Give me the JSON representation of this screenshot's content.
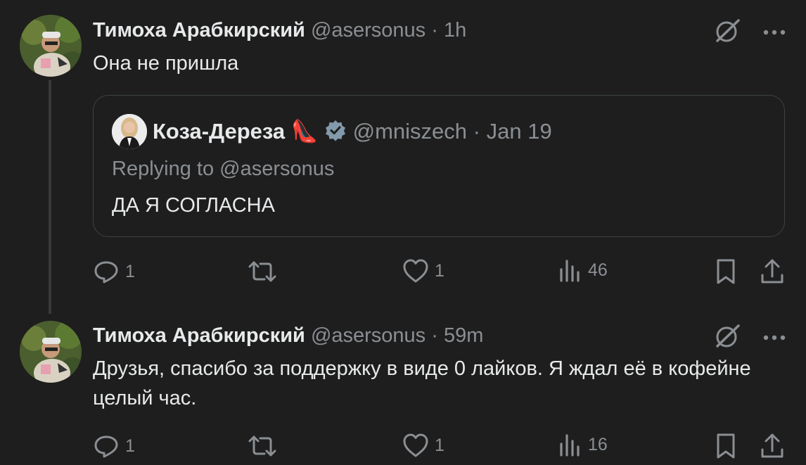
{
  "tweets": [
    {
      "author_name": "Тимоха Арабкирский",
      "handle": "@asersonus",
      "separator": "·",
      "time": "1h",
      "text": "Она не пришла",
      "quote": {
        "author_name": "Коза-Дереза",
        "emoji": "👠",
        "handle": "@mniszech",
        "separator": "·",
        "date": "Jan 19",
        "replying_to": "Replying to @asersonus",
        "text": "ДА Я СОГЛАСНА"
      },
      "actions": {
        "replies": "1",
        "retweets": "",
        "likes": "1",
        "views": "46"
      }
    },
    {
      "author_name": "Тимоха Арабкирский",
      "handle": "@asersonus",
      "separator": "·",
      "time": "59m",
      "text": "Друзья, спасибо за поддержку в виде 0 лайков. Я ждал её в кофейне целый час.",
      "actions": {
        "replies": "1",
        "retweets": "",
        "likes": "1",
        "views": "16"
      }
    }
  ],
  "colors": {
    "background": "#1e1e1e",
    "text": "#e7e9ea",
    "muted": "#8b8f93",
    "verified": "#829aab"
  },
  "icons": [
    "grok-icon",
    "more-icon",
    "reply-icon",
    "retweet-icon",
    "like-icon",
    "views-icon",
    "bookmark-icon",
    "share-icon",
    "verified-badge-icon"
  ]
}
